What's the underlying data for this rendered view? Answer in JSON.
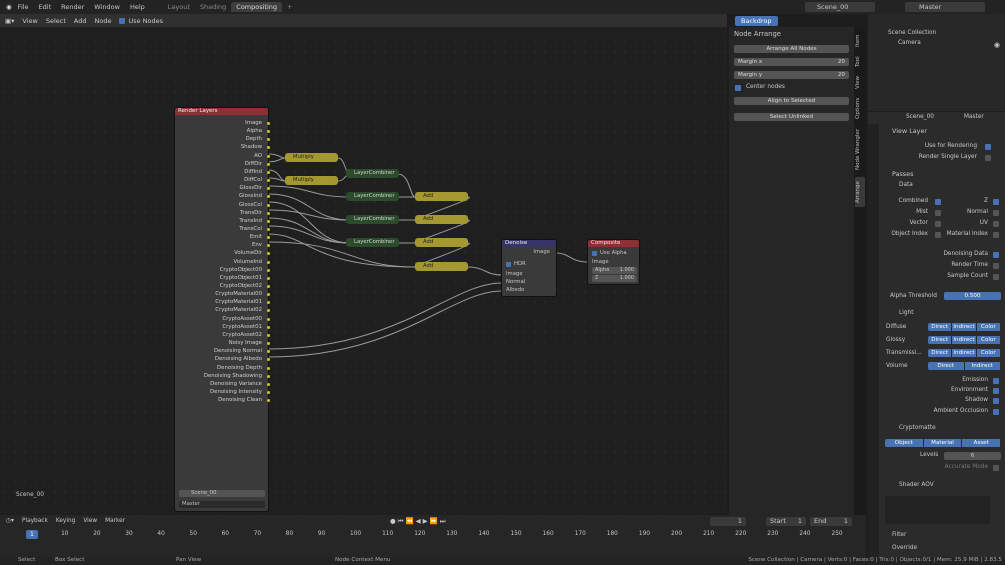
{
  "menu": [
    "File",
    "Edit",
    "Render",
    "Window",
    "Help"
  ],
  "workspace_tabs": [
    "Layout",
    "Shading",
    "Compositing"
  ],
  "active_tab": "Compositing",
  "add_tab": "+",
  "scene": "Scene_00",
  "view_layer": "Master",
  "node_header": {
    "items": [
      "View",
      "Select",
      "Add",
      "Node"
    ],
    "use_nodes": "Use Nodes",
    "backdrop": "Backdrop"
  },
  "render_layers": {
    "title": "Render Layers",
    "outputs": [
      "Image",
      "Alpha",
      "Depth",
      "Shadow",
      "AO",
      "DiffDir",
      "DiffInd",
      "DiffCol",
      "GlossDir",
      "GlossInd",
      "GlossCol",
      "TransDir",
      "TransInd",
      "TransCol",
      "Emit",
      "Env",
      "VolumeDir",
      "VolumeInd",
      "CryptoObject00",
      "CryptoObject01",
      "CryptoObject02",
      "CryptoMaterial00",
      "CryptoMaterial01",
      "CryptoMaterial02",
      "CryptoAsset00",
      "CryptoAsset01",
      "CryptoAsset02",
      "Noisy Image",
      "Denoising Normal",
      "Denoising Albedo",
      "Denoising Depth",
      "Denoising Shadowing",
      "Denoising Variance",
      "Denoising Intensity",
      "Denoising Clean"
    ],
    "scene": "Scene_00",
    "layer": "Master"
  },
  "nodes": {
    "multiply": "Multiply",
    "layer_combiner": "LayerCombiner",
    "add": "Add"
  },
  "denoise": {
    "title": "Denoise",
    "output": "Image",
    "hdr": "HDR",
    "inputs": [
      "Image",
      "Normal",
      "Albedo"
    ]
  },
  "composite": {
    "title": "Composite",
    "use_alpha": "Use Alpha",
    "inputs": [
      "Image",
      "Alpha",
      "Z"
    ],
    "alpha_val": "1.000",
    "z_val": "1.000"
  },
  "scene_label": "Scene_00",
  "node_arrange": {
    "title": "Node Arrange",
    "arrange_all": "Arrange All Nodes",
    "margin_x_label": "Margin x",
    "margin_x": "20",
    "margin_y_label": "Margin y",
    "margin_y": "20",
    "center_nodes": "Center nodes",
    "align": "Align to Selected",
    "select_unlinked": "Select Unlinked"
  },
  "side_tabs": [
    "Item",
    "Tool",
    "View",
    "Options",
    "Node Wrangler",
    "Arrange"
  ],
  "outliner": {
    "title": "Scene Collection",
    "item": "Camera"
  },
  "properties": {
    "section": "View Layer",
    "use_for_rendering": "Use for Rendering",
    "render_single": "Render Single Layer",
    "passes": "Passes",
    "data": "Data",
    "data_left": [
      "Combined",
      "Mist",
      "Vector",
      "Object Index"
    ],
    "data_right": [
      "Z",
      "Normal",
      "UV",
      "Material Index"
    ],
    "denoising_data": "Denoising Data",
    "render_time": "Render Time",
    "sample_count": "Sample Count",
    "alpha_threshold": "Alpha Threshold",
    "alpha_threshold_val": "0.500",
    "light": "Light",
    "light_rows": [
      "Diffuse",
      "Glossy",
      "Transmissi...",
      "Volume"
    ],
    "direct": "Direct",
    "indirect": "Indirect",
    "color": "Color",
    "emission": "Emission",
    "environment": "Environment",
    "shadow": "Shadow",
    "ambient_occlusion": "Ambient Occlusion",
    "cryptomatte": "Cryptomatte",
    "crypto_tabs": [
      "Object",
      "Material",
      "Asset"
    ],
    "levels": "Levels",
    "levels_val": "6",
    "accurate_mode": "Accurate Mode",
    "shader_aov": "Shader AOV",
    "filter": "Filter",
    "override": "Override"
  },
  "timeline": {
    "menus": [
      "Playback",
      "Keying",
      "View",
      "Marker"
    ],
    "current": "1",
    "start_label": "Start",
    "start": "1",
    "end_label": "End",
    "end": "1",
    "ticks": [
      "1",
      "10",
      "20",
      "30",
      "40",
      "50",
      "60",
      "70",
      "80",
      "90",
      "100",
      "110",
      "120",
      "130",
      "140",
      "150",
      "160",
      "170",
      "180",
      "190",
      "200",
      "210",
      "220",
      "230",
      "240",
      "250"
    ]
  },
  "status": {
    "select": "Select",
    "box_select": "Box Select",
    "pan_view": "Pan View",
    "context": "Node Context Menu",
    "stats": "Scene Collection | Camera | Verts:0 | Faces:0 | Tris:0 | Objects:0/1 | Mem: 25.9 MiB | 2.83.5"
  },
  "colors": {
    "accent": "#4772b3",
    "render_header": "#8e2f36",
    "denoise_header": "#35356a",
    "math_node": "#a49831",
    "combiner": "#2b4b2b"
  }
}
